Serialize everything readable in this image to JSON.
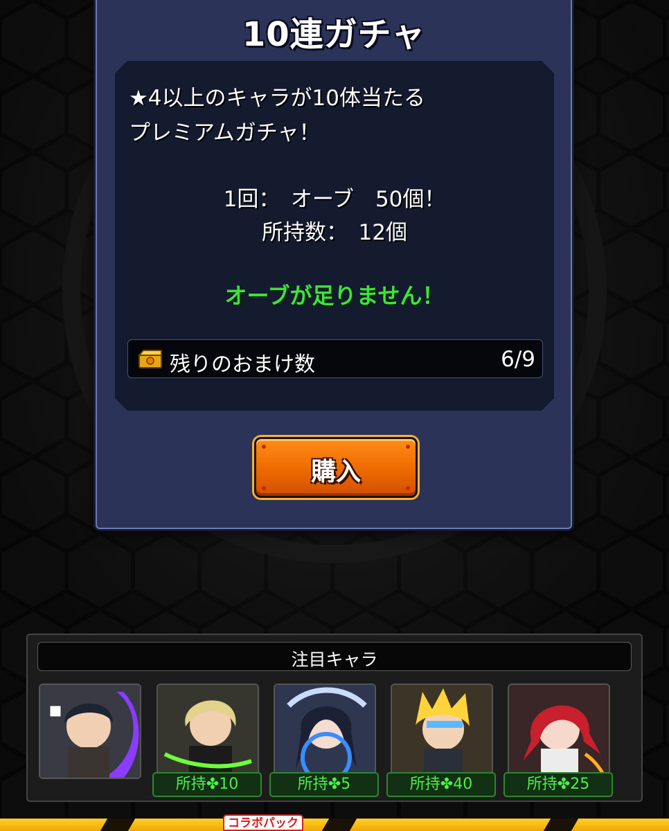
{
  "dialog": {
    "title": "10連ガチャ",
    "description_line1": "★4以上のキャラが10体当たる",
    "description_line2": "プレミアムガチャ！",
    "price_line": "1回：　オーブ　50個！",
    "owned_line": "所持数：　12個",
    "warning": "オーブが足りません！",
    "bonus": {
      "label": "残りのおまけ数",
      "count": "6/9",
      "icon": "treasure-box-icon"
    },
    "buy_label": "購入"
  },
  "featured": {
    "title": "注目キャラ",
    "characters": [
      {
        "name": "character-1",
        "owned": ""
      },
      {
        "name": "character-2",
        "owned": "所持✤10"
      },
      {
        "name": "character-3",
        "owned": "所持✤5"
      },
      {
        "name": "character-4",
        "owned": "所持✤40"
      },
      {
        "name": "character-5",
        "owned": "所持✤25"
      }
    ]
  },
  "bottom_nav": {
    "collab_badge": "コラボパック"
  },
  "colors": {
    "dialog_bg": "#2b3358",
    "warning": "#3de43a",
    "buy_button": "#f06d00",
    "owned_text": "#4cf04a"
  }
}
